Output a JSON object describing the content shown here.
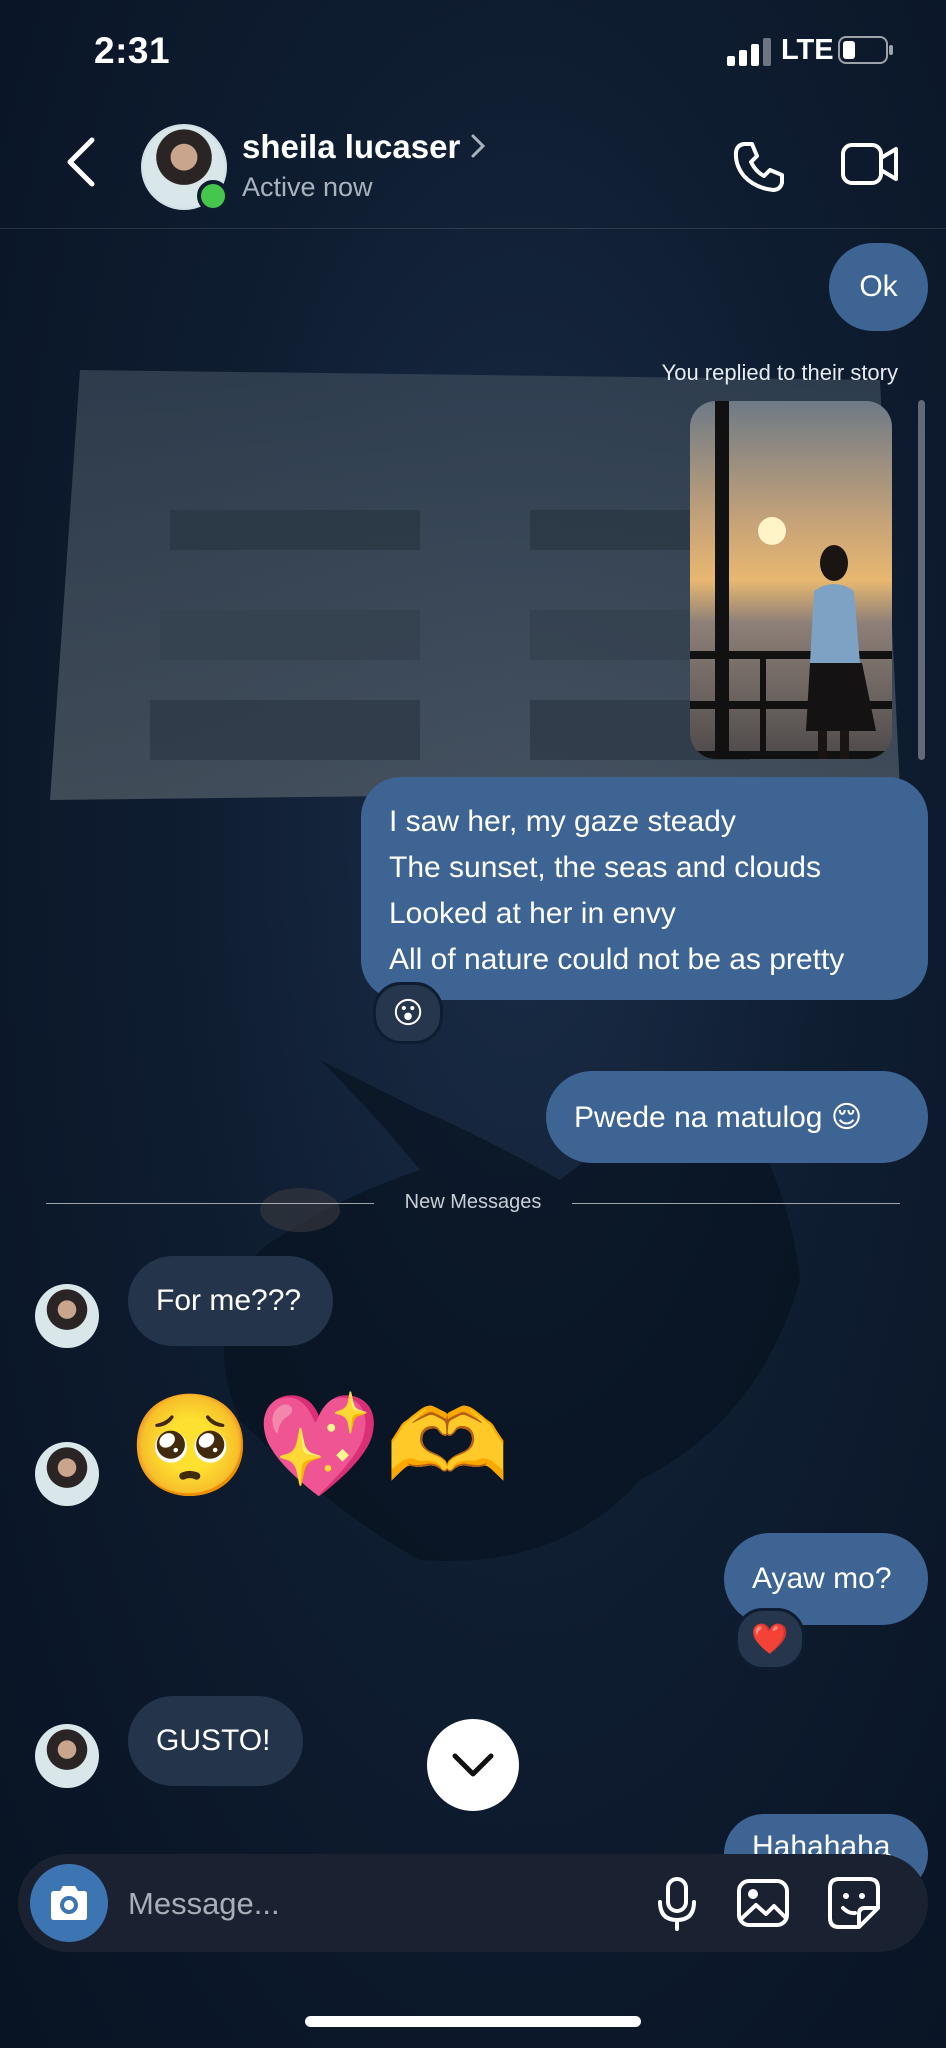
{
  "status_bar": {
    "time": "2:31",
    "network": "LTE"
  },
  "header": {
    "name": "sheila lucaser",
    "status": "Active now"
  },
  "thread": {
    "msg_ok": "Ok",
    "story_reply_label": "You replied to their story",
    "poem": [
      "I saw her, my gaze steady",
      "The sunset, the seas and clouds",
      "Looked at her in envy",
      "All of nature could not be as pretty"
    ],
    "poem_reaction": "😮",
    "msg_pwede": "Pwede na matulog 😌",
    "new_messages_label": "New Messages",
    "msg_forme": "For me???",
    "emoji_message": "🥺💖🫶",
    "msg_ayaw": "Ayaw mo?",
    "ayaw_reaction": "❤️",
    "msg_gusto": "GUSTO!",
    "msg_partial": "Hahahaha"
  },
  "composer": {
    "placeholder": "Message..."
  }
}
